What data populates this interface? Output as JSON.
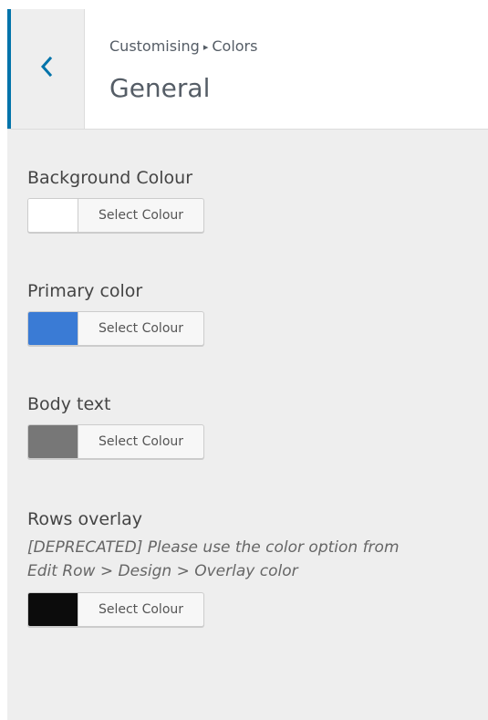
{
  "header": {
    "breadcrumb_root": "Customising",
    "breadcrumb_separator": "▸",
    "breadcrumb_current": "Colors",
    "title": "General",
    "back_icon": "chevron-left-icon"
  },
  "controls": [
    {
      "label": "Background Colour",
      "button_label": "Select Colour",
      "color": "#ffffff"
    },
    {
      "label": "Primary color",
      "button_label": "Select Colour",
      "color": "#3a7bd5"
    },
    {
      "label": "Body text",
      "button_label": "Select Colour",
      "color": "#777777"
    },
    {
      "label": "Rows overlay",
      "description_line1": "[DEPRECATED] Please use the color option from",
      "description_line2": "Edit Row > Design > Overlay color",
      "button_label": "Select Colour",
      "color": "#0c0c0c"
    }
  ],
  "theme": {
    "accent": "#0073aa",
    "panel_background": "#eeeeee"
  }
}
